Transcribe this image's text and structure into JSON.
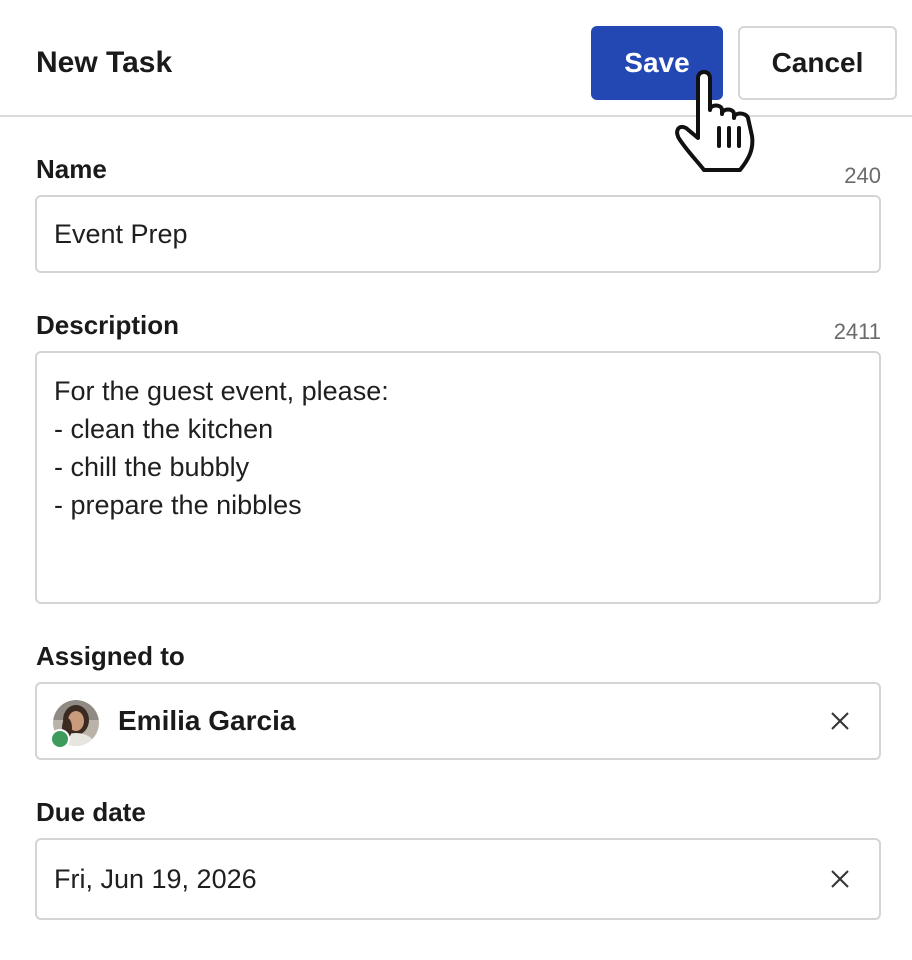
{
  "header": {
    "title": "New Task",
    "save_label": "Save",
    "cancel_label": "Cancel"
  },
  "colors": {
    "primary": "#2347b3",
    "presence_online": "#3d9b5b"
  },
  "fields": {
    "name": {
      "label": "Name",
      "counter": "240",
      "value": "Event Prep"
    },
    "description": {
      "label": "Description",
      "counter": "2411",
      "value": "For the guest event, please:\n- clean the kitchen\n- chill the bubbly\n- prepare the nibbles"
    },
    "assigned_to": {
      "label": "Assigned to",
      "value": "Emilia Garcia",
      "status": "online",
      "clear_icon": "close-icon"
    },
    "due_date": {
      "label": "Due date",
      "value": "Fri, Jun 19, 2026",
      "clear_icon": "close-icon"
    }
  },
  "cursor": {
    "icon": "hand-pointer-cursor"
  }
}
